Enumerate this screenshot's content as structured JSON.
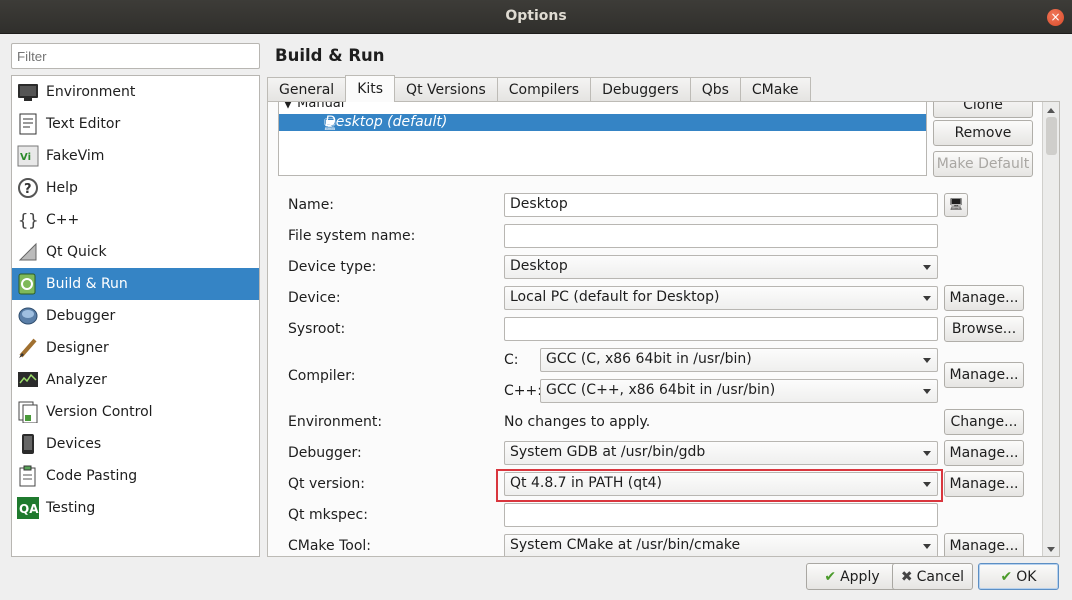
{
  "window": {
    "title": "Options",
    "close_glyph": "×"
  },
  "filter": {
    "placeholder": "Filter"
  },
  "categories": [
    {
      "label": "Environment",
      "icon": "monitor-icon"
    },
    {
      "label": "Text Editor",
      "icon": "text-editor-icon"
    },
    {
      "label": "FakeVim",
      "icon": "fakevim-icon"
    },
    {
      "label": "Help",
      "icon": "help-icon"
    },
    {
      "label": "C++",
      "icon": "cpp-braces-icon"
    },
    {
      "label": "Qt Quick",
      "icon": "qt-quick-icon"
    },
    {
      "label": "Build & Run",
      "icon": "build-run-icon",
      "selected": true
    },
    {
      "label": "Debugger",
      "icon": "debugger-icon"
    },
    {
      "label": "Designer",
      "icon": "designer-icon"
    },
    {
      "label": "Analyzer",
      "icon": "analyzer-icon"
    },
    {
      "label": "Version Control",
      "icon": "version-control-icon"
    },
    {
      "label": "Devices",
      "icon": "devices-icon"
    },
    {
      "label": "Code Pasting",
      "icon": "code-pasting-icon"
    },
    {
      "label": "Testing",
      "icon": "testing-icon"
    }
  ],
  "page": {
    "heading": "Build & Run"
  },
  "tabs": [
    "General",
    "Kits",
    "Qt Versions",
    "Compilers",
    "Debuggers",
    "Qbs",
    "CMake"
  ],
  "active_tab": "Kits",
  "kit_tree": {
    "group": "Manual",
    "selected_kit": "Desktop (default)"
  },
  "kit_buttons": {
    "clone": "Clone",
    "remove": "Remove",
    "make_default": "Make Default"
  },
  "form": {
    "name_label": "Name:",
    "name_value": "Desktop",
    "fsname_label": "File system name:",
    "fsname_value": "",
    "device_type_label": "Device type:",
    "device_type_value": "Desktop",
    "device_label": "Device:",
    "device_value": "Local PC (default for Desktop)",
    "sysroot_label": "Sysroot:",
    "sysroot_value": "",
    "compiler_label": "Compiler:",
    "compiler_c_label": "C:",
    "compiler_c_value": "GCC (C, x86 64bit in /usr/bin)",
    "compiler_cpp_label": "C++:",
    "compiler_cpp_value": "GCC (C++, x86 64bit in /usr/bin)",
    "environment_label": "Environment:",
    "environment_value": "No changes to apply.",
    "debugger_label": "Debugger:",
    "debugger_value": "System GDB at /usr/bin/gdb",
    "qt_version_label": "Qt version:",
    "qt_version_value": "Qt 4.8.7 in PATH (qt4)",
    "mkspec_label": "Qt mkspec:",
    "mkspec_value": "",
    "cmake_label": "CMake Tool:",
    "cmake_value": "System CMake at /usr/bin/cmake"
  },
  "side_buttons": {
    "manage": "Manage...",
    "browse": "Browse...",
    "change": "Change..."
  },
  "footer": {
    "apply": "Apply",
    "cancel": "Cancel",
    "ok": "OK"
  },
  "colors": {
    "selection": "#3584c5",
    "highlight_box": "#d9363e"
  }
}
